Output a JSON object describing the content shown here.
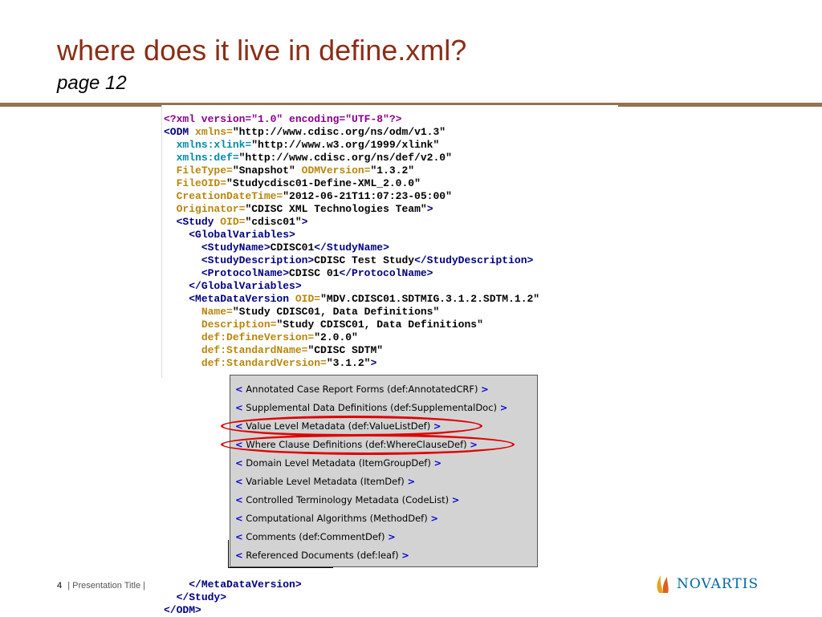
{
  "slide": {
    "title": "where does it live in define.xml?",
    "subtitle": "page 12"
  },
  "code": {
    "lines": [
      [
        {
          "c": "meta",
          "t": "<?xml version=\"1.0\" encoding=\"UTF-8\"?>"
        }
      ],
      [
        {
          "c": "tag",
          "t": "<ODM "
        },
        {
          "c": "attr-name",
          "t": "xmlns="
        },
        {
          "c": "attr-val",
          "t": "\"http://www.cdisc.org/ns/odm/v1.3\""
        }
      ],
      [
        {
          "c": "text",
          "t": "  "
        },
        {
          "c": "attr-name-teal",
          "t": "xmlns:xlink="
        },
        {
          "c": "attr-val",
          "t": "\"http://www.w3.org/1999/xlink\""
        }
      ],
      [
        {
          "c": "text",
          "t": "  "
        },
        {
          "c": "attr-name-teal",
          "t": "xmlns:def="
        },
        {
          "c": "attr-val",
          "t": "\"http://www.cdisc.org/ns/def/v2.0\""
        }
      ],
      [
        {
          "c": "text",
          "t": "  "
        },
        {
          "c": "attr-name",
          "t": "FileType="
        },
        {
          "c": "attr-val",
          "t": "\"Snapshot\" "
        },
        {
          "c": "attr-name",
          "t": "ODMVersion="
        },
        {
          "c": "attr-val",
          "t": "\"1.3.2\""
        }
      ],
      [
        {
          "c": "text",
          "t": "  "
        },
        {
          "c": "attr-name",
          "t": "FileOID="
        },
        {
          "c": "attr-val",
          "t": "\"Studycdisc01-Define-XML_2.0.0\""
        }
      ],
      [
        {
          "c": "text",
          "t": "  "
        },
        {
          "c": "attr-name",
          "t": "CreationDateTime="
        },
        {
          "c": "attr-val",
          "t": "\"2012-06-21T11:07:23-05:00\""
        }
      ],
      [
        {
          "c": "text",
          "t": "  "
        },
        {
          "c": "attr-name",
          "t": "Originator="
        },
        {
          "c": "attr-val",
          "t": "\"CDISC XML Technologies Team\""
        },
        {
          "c": "tag",
          "t": ">"
        }
      ],
      [
        {
          "c": "text",
          "t": "  "
        },
        {
          "c": "tag",
          "t": "<Study "
        },
        {
          "c": "attr-name",
          "t": "OID="
        },
        {
          "c": "attr-val",
          "t": "\"cdisc01\""
        },
        {
          "c": "tag",
          "t": ">"
        }
      ],
      [
        {
          "c": "text",
          "t": "    "
        },
        {
          "c": "tag",
          "t": "<GlobalVariables>"
        }
      ],
      [
        {
          "c": "text",
          "t": "      "
        },
        {
          "c": "tag",
          "t": "<StudyName>"
        },
        {
          "c": "text",
          "t": "CDISC01"
        },
        {
          "c": "tag",
          "t": "</StudyName>"
        }
      ],
      [
        {
          "c": "text",
          "t": "      "
        },
        {
          "c": "tag",
          "t": "<StudyDescription>"
        },
        {
          "c": "text",
          "t": "CDISC Test Study"
        },
        {
          "c": "tag",
          "t": "</StudyDescription>"
        }
      ],
      [
        {
          "c": "text",
          "t": "      "
        },
        {
          "c": "tag",
          "t": "<ProtocolName>"
        },
        {
          "c": "text",
          "t": "CDISC 01"
        },
        {
          "c": "tag",
          "t": "</ProtocolName>"
        }
      ],
      [
        {
          "c": "text",
          "t": "    "
        },
        {
          "c": "tag",
          "t": "</GlobalVariables>"
        }
      ],
      [
        {
          "c": "text",
          "t": "    "
        },
        {
          "c": "tag",
          "t": "<MetaDataVersion "
        },
        {
          "c": "attr-name",
          "t": "OID="
        },
        {
          "c": "attr-val",
          "t": "\"MDV.CDISC01.SDTMIG.3.1.2.SDTM.1.2\""
        }
      ],
      [
        {
          "c": "text",
          "t": "      "
        },
        {
          "c": "attr-name",
          "t": "Name="
        },
        {
          "c": "attr-val",
          "t": "\"Study CDISC01, Data Definitions\""
        }
      ],
      [
        {
          "c": "text",
          "t": "      "
        },
        {
          "c": "attr-name",
          "t": "Description="
        },
        {
          "c": "attr-val",
          "t": "\"Study CDISC01, Data Definitions\""
        }
      ],
      [
        {
          "c": "text",
          "t": "      "
        },
        {
          "c": "attr-name",
          "t": "def:DefineVersion="
        },
        {
          "c": "attr-val",
          "t": "\"2.0.0\""
        }
      ],
      [
        {
          "c": "text",
          "t": "      "
        },
        {
          "c": "attr-name",
          "t": "def:StandardName="
        },
        {
          "c": "attr-val",
          "t": "\"CDISC SDTM\""
        }
      ],
      [
        {
          "c": "text",
          "t": "      "
        },
        {
          "c": "attr-name",
          "t": "def:StandardVersion="
        },
        {
          "c": "attr-val",
          "t": "\"3.1.2\""
        },
        {
          "c": "tag",
          "t": ">"
        }
      ]
    ],
    "closing": [
      [
        {
          "c": "text",
          "t": "    "
        },
        {
          "c": "tag",
          "t": "</MetaDataVersion>"
        }
      ],
      [
        {
          "c": "text",
          "t": "  "
        },
        {
          "c": "tag",
          "t": "</Study>"
        }
      ],
      [
        {
          "c": "tag",
          "t": "</ODM>"
        }
      ]
    ]
  },
  "menu": {
    "items": [
      {
        "label": "Annotated Case Report Forms (def:AnnotatedCRF)"
      },
      {
        "label": "Supplemental Data Definitions (def:SupplementalDoc)"
      },
      {
        "label": "Value Level Metadata (def:ValueListDef)",
        "highlighted": true
      },
      {
        "label": "Where Clause Definitions (def:WhereClauseDef)",
        "highlighted": true
      },
      {
        "label": "Domain Level Metadata (ItemGroupDef)"
      },
      {
        "label": "Variable Level Metadata (ItemDef)"
      },
      {
        "label": "Controlled Terminology Metadata (CodeList)"
      },
      {
        "label": "Computational Algorithms (MethodDef)"
      },
      {
        "label": "Comments (def:CommentDef)"
      },
      {
        "label": "Referenced Documents (def:leaf)"
      }
    ],
    "open_bracket": "<",
    "close_bracket": ">",
    "highlight_color": "#e00000"
  },
  "footer": {
    "page_number": "4",
    "text": "| Presentation Title |"
  },
  "logo": {
    "name": "NOVARTIS",
    "icon": "novartis-flame-icon",
    "color": "#0066a4"
  },
  "colors": {
    "title": "#8b2d16",
    "rule": "#957152",
    "tag": "#000080",
    "attr_name": "#b8860b",
    "namespace_attr": "#008ba8"
  }
}
